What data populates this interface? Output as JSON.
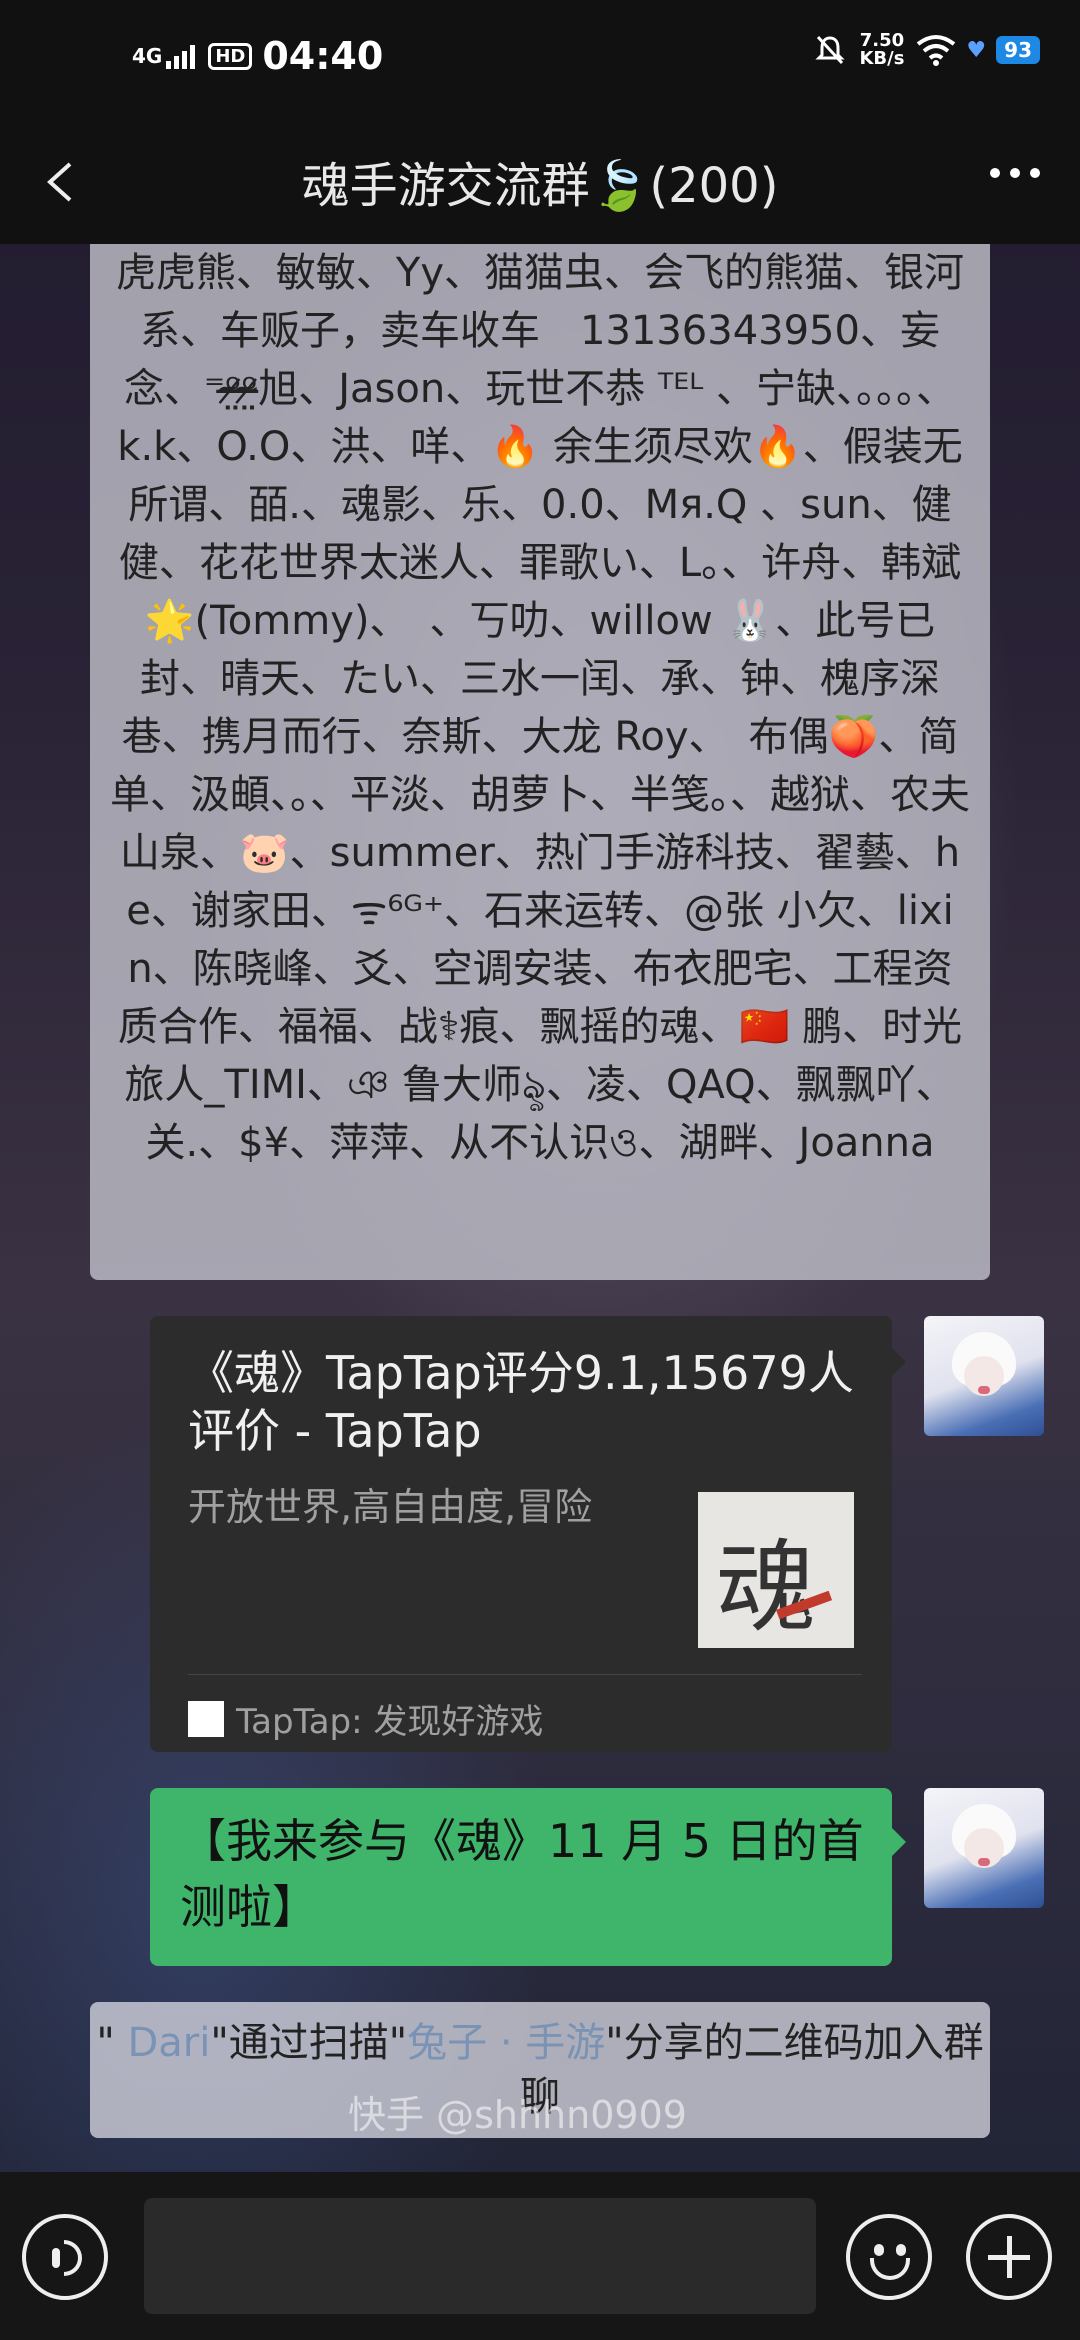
{
  "status_bar": {
    "network": "4G",
    "hd": "HD",
    "time": "04:40",
    "speed_value": "7.50",
    "speed_unit": "KB/s",
    "battery": "93"
  },
  "nav": {
    "title": "魂手游交流群🍃(200)"
  },
  "member_list_text": "虎虎熊、敏敏、Yy、猫猫虫、会飞的熊猫、银河系、车贩子，卖车收车　13136343950、妄念、⁼ᵒ̴̶̷̤ᵒ̴̶̷̤旭、Jason、玩世不恭 ᵀᴱᴸ 、宁缺、。。。、k.k、O.O、洪、咩、🔥 余生须尽欢🔥、假装无所谓、皕.、魂影、乐、0.0、Mя.Q 、sun、健健、花花世界太迷人、罪歌い、L。、许舟、韩斌🌟(Tommy)、　、丂叻、willow 🐰、此号已封、晴天、たい、三水一闰、承、钟、槐序深巷、携月而行、奈斯、大龙 Roy、　布偶🍑、简单、汲頔、。、平淡、胡萝卜、半笺。、越狱、农夫山泉、🐷、summer、热门手游科技、翟藝、he、谢家田、ᯤ⁶ᴳ⁺、石来运转、@张 小欠、lixin、陈晓峰、爻、空调安装、布衣肥宅、工程资质合作、福福、战⚕痕、飘摇的魂、🇨🇳 鹏、时光旅人_TIMI、ঞ 鲁大师ৡ、凌、QAQ、飘飘吖、关.、$¥、萍萍、从不认识ও、湖畔、Joanna",
  "link_card": {
    "title": "《魂》TapTap评分9.1,15679人评价 - TapTap",
    "description": "开放世界,高自由度,冒险",
    "thumb_glyph": "魂",
    "source": "TapTap: 发现好游戏"
  },
  "text_message": {
    "text": "【我来参与《魂》11 月 5 日的首测啦】"
  },
  "system_message": {
    "prefix": "\" ",
    "inviter": "Dari",
    "mid": "\"通过扫描\"",
    "sharer": "兔子 · 手游",
    "suffix": "\"分享的二维码加入群聊"
  },
  "watermark": "快手 @shhhn0909",
  "colors": {
    "bubble_green": "#3fb56b",
    "card_bg": "#2c2c2c",
    "link_blue": "#7a93b5"
  }
}
